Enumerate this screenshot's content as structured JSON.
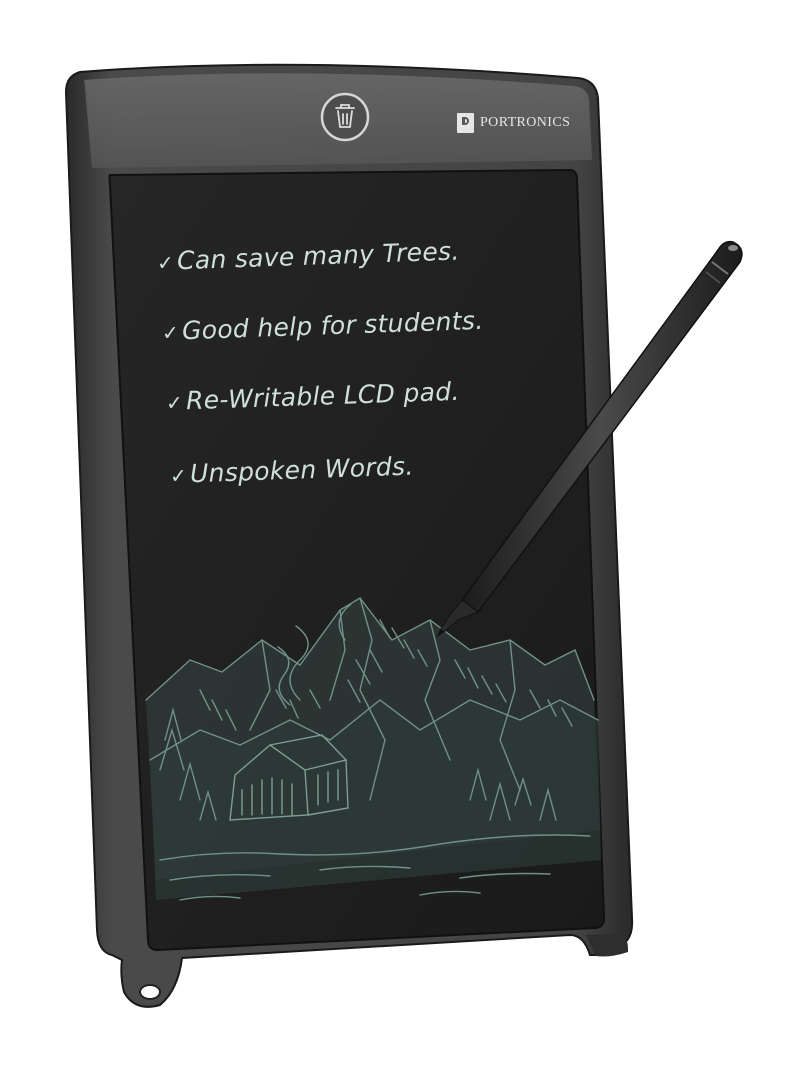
{
  "device": {
    "brand": "PORTRONICS",
    "screen_lines": [
      "Can save many Trees.",
      "Good help for students.",
      "Re-Writable LCD pad.",
      "Unspoken Words."
    ],
    "check_glyph": "✓",
    "icons": [
      "trash-icon",
      "brand-logo",
      "stylus"
    ],
    "colors": {
      "body": "#3f3f3f",
      "top_panel": "#5a5a5a",
      "screen": "#1f1f1f",
      "ink": "#cfe0db"
    }
  }
}
